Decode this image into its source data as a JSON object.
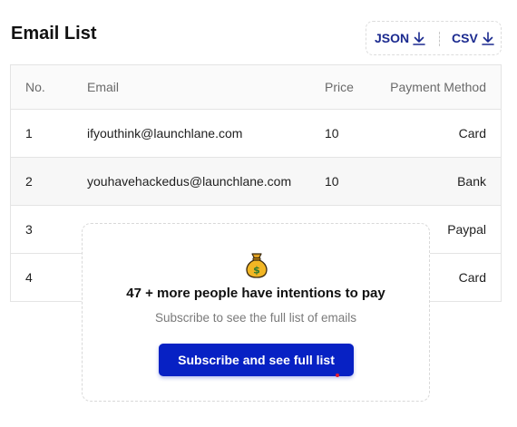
{
  "page": {
    "title": "Email List"
  },
  "export": {
    "json_label": "JSON",
    "csv_label": "CSV",
    "icon": "download-arrow-icon",
    "color": "#1b2a8f"
  },
  "table": {
    "headers": {
      "no": "No.",
      "email": "Email",
      "price": "Price",
      "payment": "Payment Method"
    },
    "rows": [
      {
        "no": "1",
        "email": "ifyouthink@launchlane.com",
        "price": "10",
        "payment": "Card"
      },
      {
        "no": "2",
        "email": "youhavehackedus@launchlane.com",
        "price": "10",
        "payment": "Bank"
      },
      {
        "no": "3",
        "email": "",
        "price": "",
        "payment": "Paypal"
      },
      {
        "no": "4",
        "email": "",
        "price": "",
        "payment": "Card"
      }
    ]
  },
  "paywall": {
    "icon": "money-bag-icon",
    "headline": "47 + more people have intentions to pay",
    "subtext": "Subscribe to see the full list of emails",
    "button_label": "Subscribe and see full list",
    "button_color": "#0721c4"
  }
}
